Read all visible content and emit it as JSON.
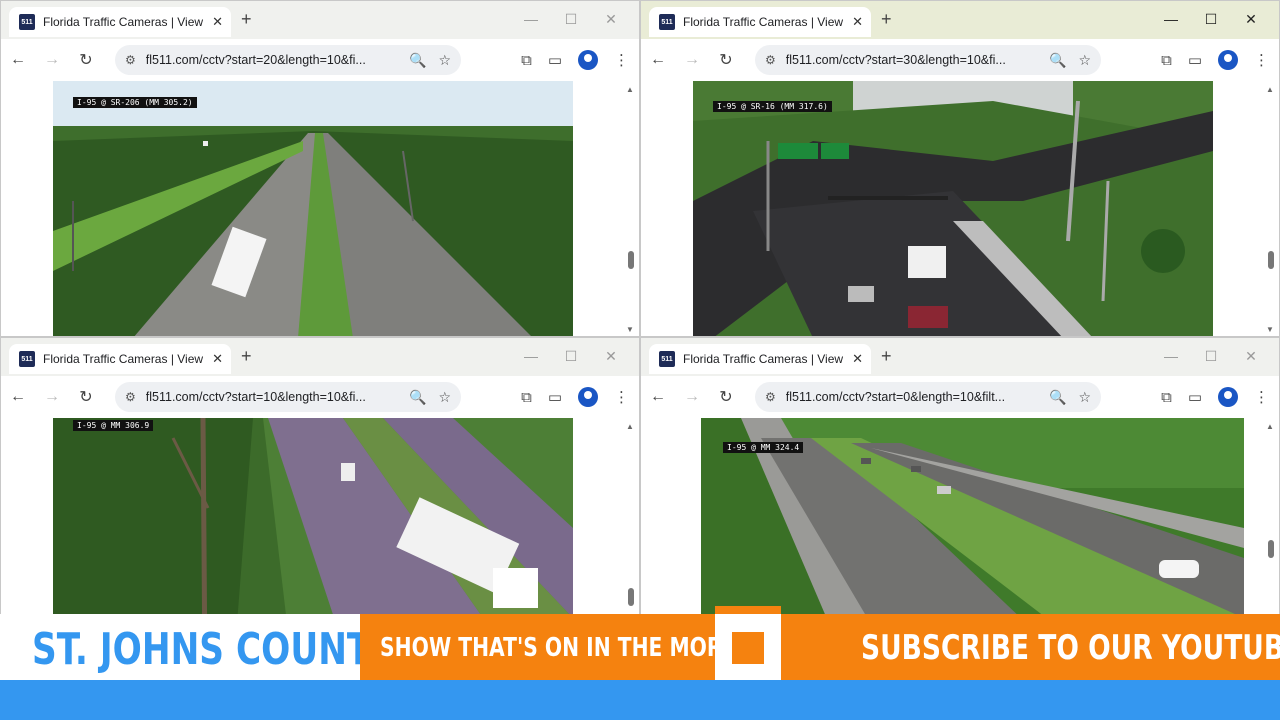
{
  "windows": [
    {
      "tab_title": "Florida Traffic Cameras | View Li",
      "favicon_text": "511",
      "url": "fl511.com/cctv?start=20&length=10&fi...",
      "camera_label": "I-95 @ SR-206 (MM 305.2)"
    },
    {
      "tab_title": "Florida Traffic Cameras | View Li",
      "favicon_text": "511",
      "url": "fl511.com/cctv?start=30&length=10&fi...",
      "camera_label": "I-95 @ SR-16 (MM 317.6)"
    },
    {
      "tab_title": "Florida Traffic Cameras | View Li",
      "favicon_text": "511",
      "url": "fl511.com/cctv?start=10&length=10&fi...",
      "camera_label": "I-95 @ MM 306.9"
    },
    {
      "tab_title": "Florida Traffic Cameras | View Li",
      "favicon_text": "511",
      "url": "fl511.com/cctv?start=0&length=10&filt...",
      "camera_label": "I-95 @ MM 324.4"
    }
  ],
  "glyphs": {
    "close": "✕",
    "new_tab": "+",
    "minimize": "—",
    "maximize": "☐",
    "back": "←",
    "forward": "→",
    "reload": "↻",
    "tune": "⚙",
    "zoom": "🔍",
    "star": "☆",
    "extensions": "⧉",
    "cast": "▭",
    "menu": "⋮"
  },
  "banner": {
    "county": "ST. JOHNS COUNTY",
    "show": "SHOW THAT'S ON IN THE MORNING",
    "subscribe": "SUBSCRIBE TO OUR YOUTUBE!",
    "colors": {
      "orange": "#f5820f",
      "blue": "#3497f0",
      "white": "#ffffff"
    }
  }
}
